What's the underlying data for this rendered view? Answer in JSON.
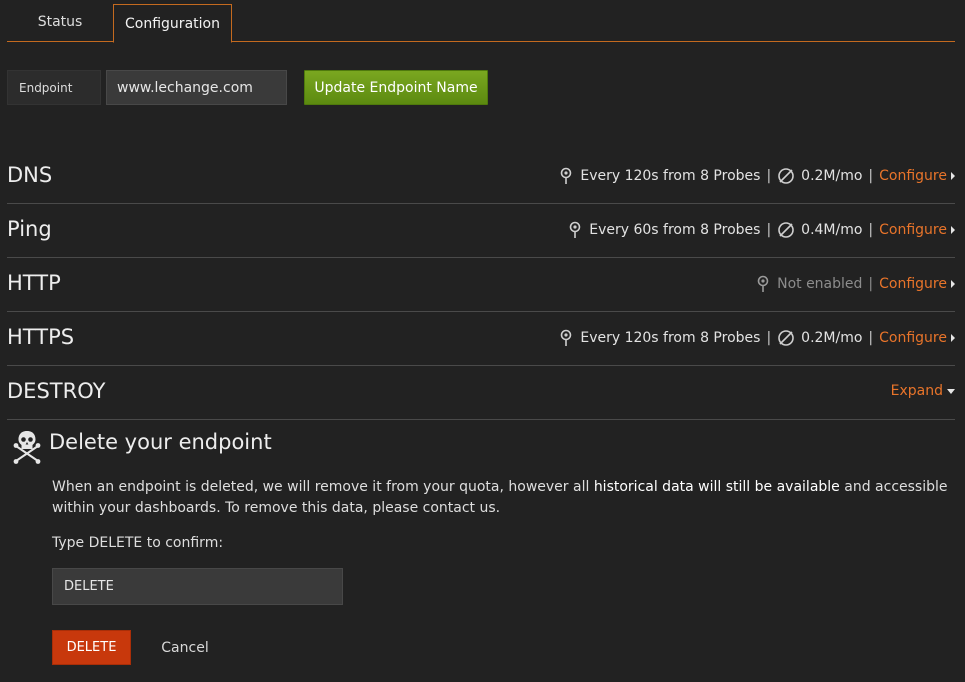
{
  "tabs": [
    {
      "label": "Status",
      "active": false
    },
    {
      "label": "Configuration",
      "active": true
    }
  ],
  "endpoint": {
    "label": "Endpoint",
    "value": "www.lechange.com",
    "update_button": "Update Endpoint Name"
  },
  "sections": [
    {
      "title": "DNS",
      "frequency": "Every 120s from 8 Probes",
      "usage": "0.2M/mo",
      "action": "Configure"
    },
    {
      "title": "Ping",
      "frequency": "Every 60s from 8 Probes",
      "usage": "0.4M/mo",
      "action": "Configure"
    },
    {
      "title": "HTTP",
      "status": "Not enabled",
      "action": "Configure"
    },
    {
      "title": "HTTPS",
      "frequency": "Every 120s from 8 Probes",
      "usage": "0.2M/mo",
      "action": "Configure"
    },
    {
      "title": "DESTROY",
      "action": "Expand"
    }
  ],
  "delete_panel": {
    "title": "Delete your endpoint",
    "desc_before": "When an endpoint is deleted, we will remove it from your quota, however all ",
    "desc_bold": "historical data will still be available",
    "desc_after": " and accessible within your dashboards. To remove this data, please contact us.",
    "confirm_label": "Type DELETE to confirm:",
    "confirm_value": "DELETE",
    "delete_button": "DELETE",
    "cancel_button": "Cancel"
  },
  "colors": {
    "background": "#222222",
    "accent": "#e8742a",
    "primary_button": "#6b9a18",
    "danger_button": "#c8380c"
  },
  "icons": {
    "probe": "probe-icon",
    "usage": "usage-meter-icon",
    "skull": "skull-crossbones-icon"
  }
}
